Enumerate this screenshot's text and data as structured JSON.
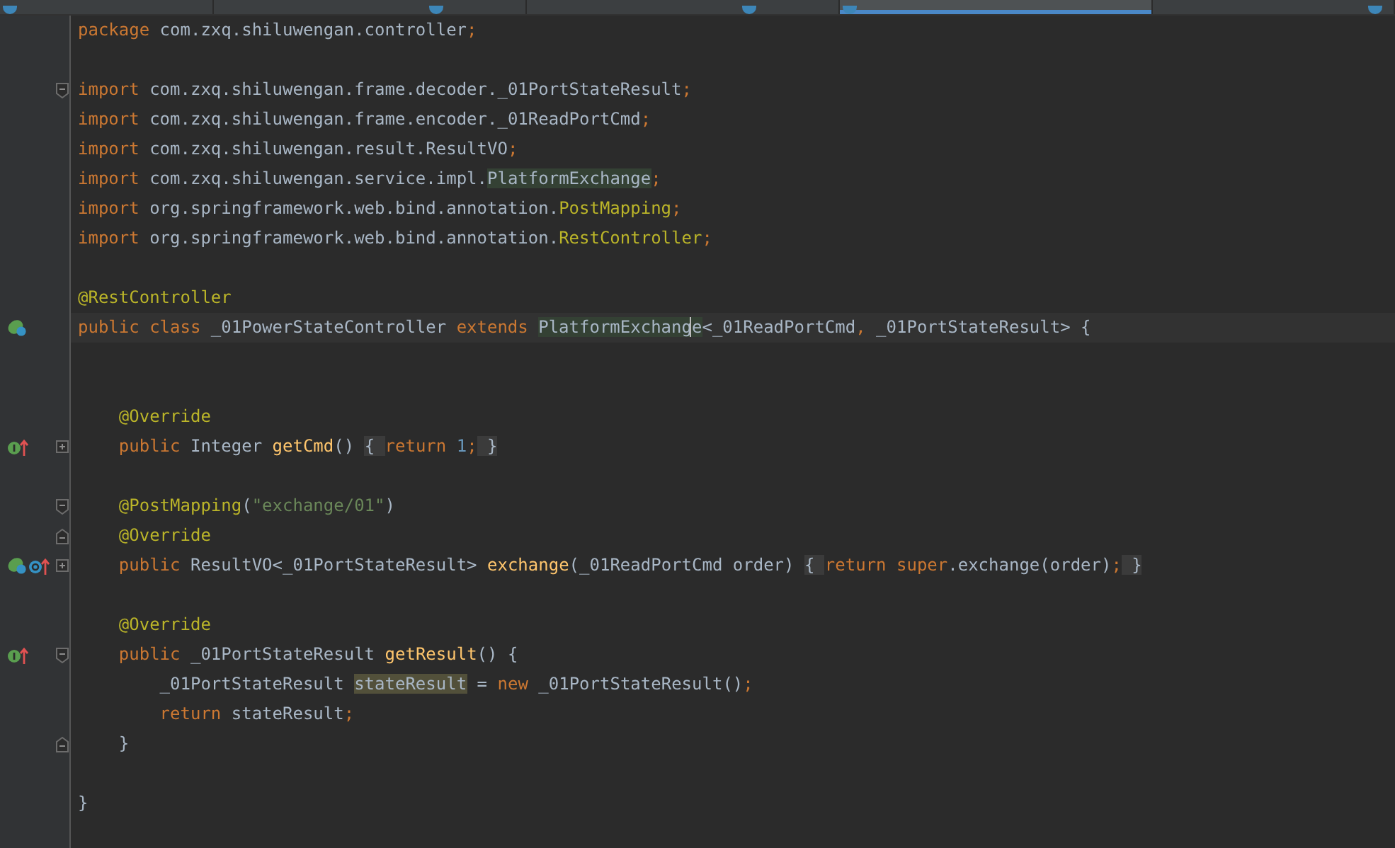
{
  "tabs": [
    {
      "selected": false
    },
    {
      "selected": false
    },
    {
      "selected": false
    },
    {
      "selected": true
    },
    {
      "selected": false
    }
  ],
  "lines": [
    {
      "kind": "code",
      "tokens": [
        {
          "kind": "keyword",
          "text": "package "
        },
        {
          "kind": "plain",
          "text": "com.zxq.shiluwengan.controller"
        },
        {
          "kind": "keyword",
          "text": ";"
        }
      ]
    },
    {
      "kind": "blank"
    },
    {
      "kind": "code",
      "fold": {
        "kind": "start"
      },
      "tokens": [
        {
          "kind": "keyword",
          "text": "import "
        },
        {
          "kind": "plain",
          "text": "com.zxq.shiluwengan.frame.decoder._01PortStateResult"
        },
        {
          "kind": "keyword",
          "text": ";"
        }
      ]
    },
    {
      "kind": "code",
      "tokens": [
        {
          "kind": "keyword",
          "text": "import "
        },
        {
          "kind": "plain",
          "text": "com.zxq.shiluwengan.frame.encoder._01ReadPortCmd"
        },
        {
          "kind": "keyword",
          "text": ";"
        }
      ]
    },
    {
      "kind": "code",
      "tokens": [
        {
          "kind": "keyword",
          "text": "import "
        },
        {
          "kind": "plain",
          "text": "com.zxq.shiluwengan.result.ResultVO"
        },
        {
          "kind": "keyword",
          "text": ";"
        }
      ]
    },
    {
      "kind": "code",
      "tokens": [
        {
          "kind": "keyword",
          "text": "import "
        },
        {
          "kind": "plain",
          "text": "com.zxq.shiluwengan.service.impl."
        },
        {
          "kind": "usage",
          "text": "PlatformExchange"
        },
        {
          "kind": "keyword",
          "text": ";"
        }
      ]
    },
    {
      "kind": "code",
      "tokens": [
        {
          "kind": "keyword",
          "text": "import "
        },
        {
          "kind": "plain",
          "text": "org.springframework.web.bind.annotation."
        },
        {
          "kind": "annotation",
          "text": "PostMapping"
        },
        {
          "kind": "keyword",
          "text": ";"
        }
      ]
    },
    {
      "kind": "code",
      "tokens": [
        {
          "kind": "keyword",
          "text": "import "
        },
        {
          "kind": "plain",
          "text": "org.springframework.web.bind.annotation."
        },
        {
          "kind": "annotation",
          "text": "RestController"
        },
        {
          "kind": "keyword",
          "text": ";"
        }
      ]
    },
    {
      "kind": "blank"
    },
    {
      "kind": "code",
      "tokens": [
        {
          "kind": "annotation",
          "text": "@RestController"
        }
      ]
    },
    {
      "kind": "code",
      "current": true,
      "markers": [
        {
          "kind": "bean"
        }
      ],
      "tokens": [
        {
          "kind": "keyword",
          "text": "public class "
        },
        {
          "kind": "plain",
          "text": "_01PowerStateController "
        },
        {
          "kind": "keyword",
          "text": "extends "
        },
        {
          "kind": "usage",
          "text": "PlatformExchang"
        },
        {
          "kind": "caret",
          "text": "e"
        },
        {
          "kind": "plain",
          "text": "<_01ReadPortCmd"
        },
        {
          "kind": "keyword",
          "text": ", "
        },
        {
          "kind": "plain",
          "text": "_01PortStateResult> {"
        }
      ]
    },
    {
      "kind": "blank"
    },
    {
      "kind": "blank"
    },
    {
      "kind": "code",
      "tokens": [
        {
          "kind": "annotation",
          "text": "    @Override"
        }
      ]
    },
    {
      "kind": "code",
      "markers": [
        {
          "kind": "implements"
        }
      ],
      "fold": {
        "kind": "collapsed"
      },
      "tokens": [
        {
          "kind": "keyword",
          "text": "    public "
        },
        {
          "kind": "plain",
          "text": "Integer "
        },
        {
          "kind": "method",
          "text": "getCmd"
        },
        {
          "kind": "plain",
          "text": "() "
        },
        {
          "kind": "folded",
          "text": "{ "
        },
        {
          "kind": "keyword",
          "text": "return "
        },
        {
          "kind": "number",
          "text": "1"
        },
        {
          "kind": "keyword",
          "text": ";"
        },
        {
          "kind": "folded",
          "text": " }"
        }
      ]
    },
    {
      "kind": "blank"
    },
    {
      "kind": "code",
      "fold": {
        "kind": "start"
      },
      "tokens": [
        {
          "kind": "annotation",
          "text": "    @PostMapping"
        },
        {
          "kind": "plain",
          "text": "("
        },
        {
          "kind": "string",
          "text": "\"exchange/01\""
        },
        {
          "kind": "plain",
          "text": ")"
        }
      ]
    },
    {
      "kind": "code",
      "fold": {
        "kind": "end"
      },
      "tokens": [
        {
          "kind": "annotation",
          "text": "    @Override"
        }
      ]
    },
    {
      "kind": "code",
      "markers": [
        {
          "kind": "bean"
        },
        {
          "kind": "overrides"
        }
      ],
      "fold": {
        "kind": "collapsed"
      },
      "tokens": [
        {
          "kind": "keyword",
          "text": "    public "
        },
        {
          "kind": "plain",
          "text": "ResultVO<_01PortStateResult> "
        },
        {
          "kind": "method",
          "text": "exchange"
        },
        {
          "kind": "plain",
          "text": "(_01ReadPortCmd order) "
        },
        {
          "kind": "folded",
          "text": "{ "
        },
        {
          "kind": "keyword",
          "text": "return super"
        },
        {
          "kind": "plain",
          "text": ".exchange(order)"
        },
        {
          "kind": "keyword",
          "text": ";"
        },
        {
          "kind": "folded",
          "text": " }"
        }
      ]
    },
    {
      "kind": "blank"
    },
    {
      "kind": "code",
      "tokens": [
        {
          "kind": "annotation",
          "text": "    @Override"
        }
      ]
    },
    {
      "kind": "code",
      "markers": [
        {
          "kind": "implements"
        }
      ],
      "fold": {
        "kind": "start"
      },
      "tokens": [
        {
          "kind": "keyword",
          "text": "    public "
        },
        {
          "kind": "plain",
          "text": "_01PortStateResult "
        },
        {
          "kind": "method",
          "text": "getResult"
        },
        {
          "kind": "plain",
          "text": "() {"
        }
      ]
    },
    {
      "kind": "code",
      "tokens": [
        {
          "kind": "plain",
          "text": "        _01PortStateResult "
        },
        {
          "kind": "symbol",
          "text": "stateResult"
        },
        {
          "kind": "plain",
          "text": " = "
        },
        {
          "kind": "keyword",
          "text": "new "
        },
        {
          "kind": "plain",
          "text": "_01PortStateResult()"
        },
        {
          "kind": "keyword",
          "text": ";"
        }
      ]
    },
    {
      "kind": "code",
      "tokens": [
        {
          "kind": "keyword",
          "text": "        return "
        },
        {
          "kind": "plain",
          "text": "stateResult"
        },
        {
          "kind": "keyword",
          "text": ";"
        }
      ]
    },
    {
      "kind": "code",
      "fold": {
        "kind": "end"
      },
      "tokens": [
        {
          "kind": "plain",
          "text": "    }"
        }
      ]
    },
    {
      "kind": "blank"
    },
    {
      "kind": "code",
      "tokens": [
        {
          "kind": "plain",
          "text": "}"
        }
      ]
    }
  ]
}
